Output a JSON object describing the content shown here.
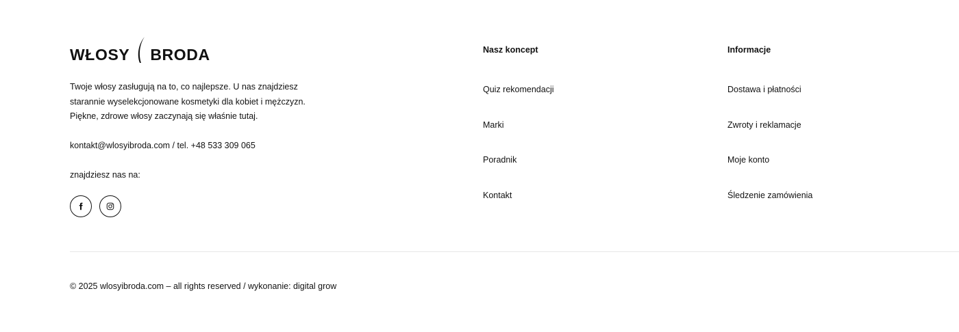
{
  "brand": {
    "word_left": "WŁOSY",
    "word_right": "BRODA"
  },
  "about": {
    "text_lines": [
      "Twoje włosy zasługują na to, co najlepsze. U nas znajdziesz",
      "starannie wyselekcjonowane kosmetyki dla kobiet i mężczyzn.",
      "Piękne, zdrowe włosy zaczynają się właśnie tutaj."
    ],
    "contact": "kontakt@wlosyibroda.com / tel. +48 533 309 065",
    "find_us": "znajdziesz nas na:",
    "socials": [
      {
        "icon": "facebook-icon"
      },
      {
        "icon": "instagram-icon"
      }
    ]
  },
  "columns": [
    {
      "title": "Nasz koncept",
      "links": [
        "Quiz rekomendacji",
        "Marki",
        "Poradnik",
        "Kontakt"
      ]
    },
    {
      "title": "Informacje",
      "links": [
        "Dostawa i płatności",
        "Zwroty i reklamacje",
        "Moje konto",
        "Śledzenie zamówienia"
      ]
    }
  ],
  "copyright": "© 2025 wlosyibroda.com – all rights reserved / wykonanie: digital grow"
}
